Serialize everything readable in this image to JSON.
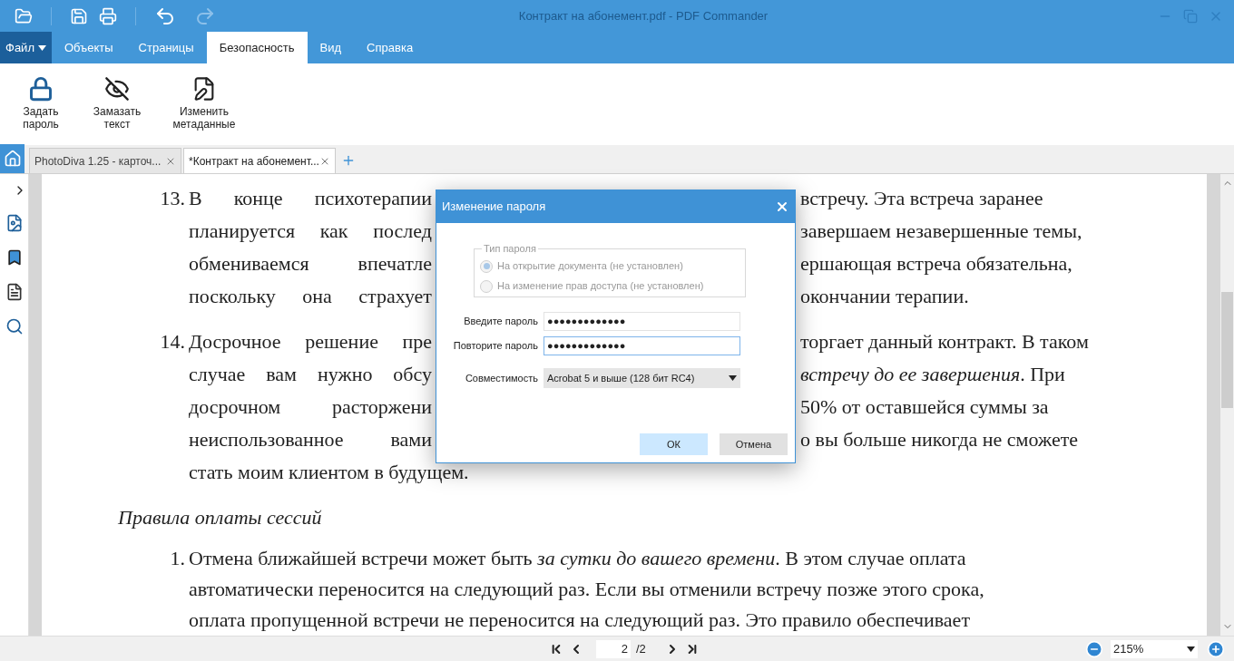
{
  "window": {
    "title": "Контракт на абонемент.pdf - PDF Commander"
  },
  "quick_access": {
    "redo_disabled": true
  },
  "menu": [
    {
      "label": "Файл",
      "kind": "file",
      "selected": false
    },
    {
      "label": "Объекты",
      "kind": "tab",
      "selected": false
    },
    {
      "label": "Страницы",
      "kind": "tab",
      "selected": false
    },
    {
      "label": "Безопасность",
      "kind": "tab",
      "selected": true
    },
    {
      "label": "Вид",
      "kind": "tab",
      "selected": false
    },
    {
      "label": "Справка",
      "kind": "tab",
      "selected": false
    }
  ],
  "ribbon": [
    {
      "lines": [
        "Задать",
        "пароль"
      ],
      "kind": "lock"
    },
    {
      "lines": [
        "Замазать",
        "текст"
      ],
      "kind": "redact"
    },
    {
      "lines": [
        "Изменить",
        "метаданные"
      ],
      "kind": "metadata"
    }
  ],
  "doc_tabs": [
    {
      "label": "PhotoDiva 1.25 - карточ...",
      "selected": false
    },
    {
      "label": "*Контракт на абонемент...",
      "selected": true
    }
  ],
  "document": [
    {
      "kind": "numbered",
      "number": "13.",
      "lines": [
        {
          "left": "В конце психотерапии",
          "right": "встречу. Эта встреча заранее"
        },
        {
          "left": "планируется как послед",
          "right": "завершаем незавершенные темы,"
        },
        {
          "left": "обмениваемся впечатле",
          "right": "ершающая встреча обязательна,"
        },
        {
          "left": "поскольку она страхует",
          "right": "окончании терапии."
        }
      ]
    },
    {
      "kind": "numbered",
      "number": "14.",
      "lines": [
        {
          "left": "Досрочное решение пре",
          "right": "торгает данный контракт. В таком"
        },
        {
          "left": "случае вам нужно обсу",
          "right": "*встречу до ее завершения*. При"
        },
        {
          "left": "досрочном расторжени",
          "right": "50% от оставшейся суммы за"
        },
        {
          "left": "неиспользованное вами",
          "right": "о вы больше никогда не сможете"
        },
        {
          "text": "стать моим клиентом в будущем."
        }
      ]
    },
    {
      "kind": "heading",
      "text": "Правила оплаты сессий"
    },
    {
      "kind": "numbered",
      "number": "1.",
      "lines": [
        {
          "text": "Отмена ближайшей встречи может быть *за сутки до вашего времени*. В этом случае оплата"
        },
        {
          "text": "автоматически переносится на следующий раз. Если вы отменили встречу позже этого срока,"
        },
        {
          "text": "оплата пропущенной встречи не переносится на следующий раз. Это правило обеспечивает"
        }
      ]
    }
  ],
  "dialog": {
    "title": "Изменение пароля",
    "password_type": {
      "legend": "Тип пароля",
      "options": [
        {
          "label": "На открытие документа (не установлен)",
          "selected": true,
          "disabled": true
        },
        {
          "label": "На изменение прав доступа (не установлен)",
          "selected": false,
          "disabled": true
        }
      ]
    },
    "fields": [
      {
        "label": "Введите пароль",
        "value": "●●●●●●●●●●●●●",
        "focused": false
      },
      {
        "label": "Повторите пароль",
        "value": "●●●●●●●●●●●●●",
        "focused": true
      }
    ],
    "compatibility": {
      "label": "Совместимость",
      "value": "Acrobat 5 и выше (128 бит RC4)"
    },
    "buttons": [
      {
        "label": "ОК",
        "kind": "primary"
      },
      {
        "label": "Отмена",
        "kind": "secondary"
      }
    ]
  },
  "navigation": {
    "page": "2",
    "total": "/2",
    "zoom": "215%"
  }
}
